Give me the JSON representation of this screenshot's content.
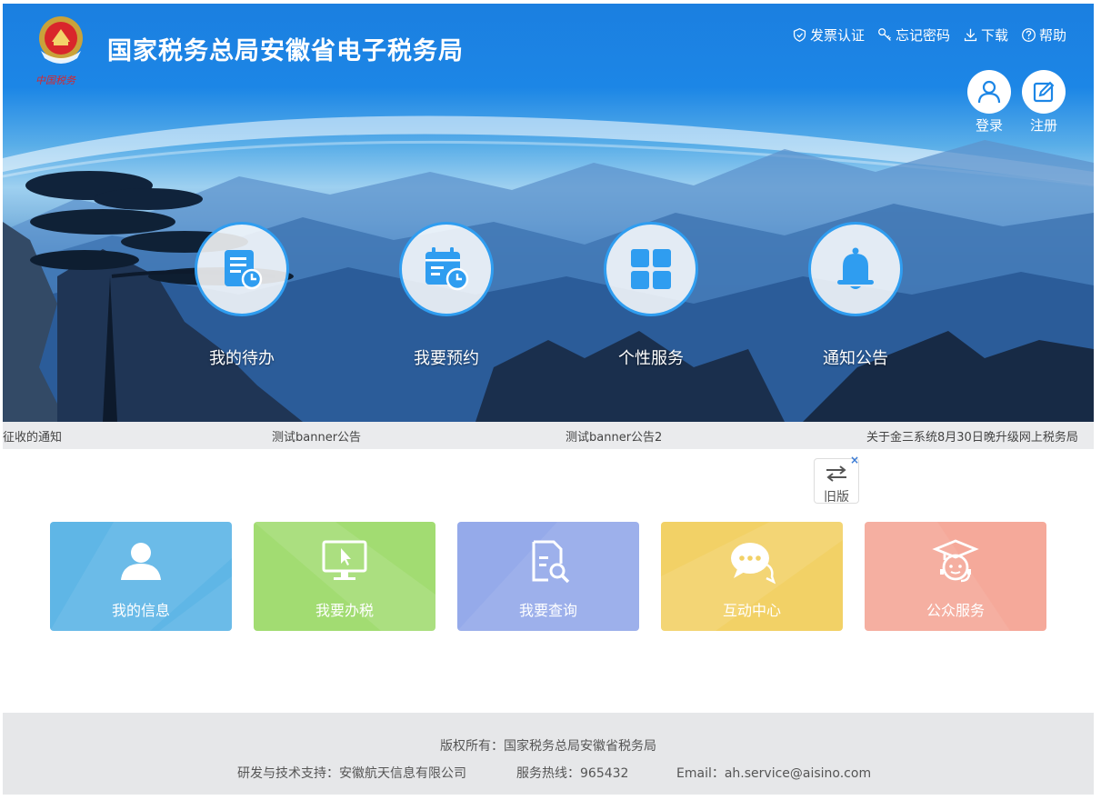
{
  "header": {
    "title": "国家税务总局安徽省电子税务局",
    "logo_text": "中国税务",
    "links": [
      {
        "label": "发票认证",
        "icon": "shield-check-icon"
      },
      {
        "label": "忘记密码",
        "icon": "key-icon"
      },
      {
        "label": "下载",
        "icon": "download-icon"
      },
      {
        "label": "帮助",
        "icon": "help-icon"
      }
    ],
    "login_label": "登录",
    "register_label": "注册"
  },
  "features": [
    {
      "label": "我的待办",
      "icon": "todo-document-icon"
    },
    {
      "label": "我要预约",
      "icon": "calendar-clock-icon"
    },
    {
      "label": "个性服务",
      "icon": "grid-icon"
    },
    {
      "label": "通知公告",
      "icon": "bell-icon"
    }
  ],
  "marquee": [
    "征收的通知",
    "测试banner公告",
    "测试banner公告2",
    "关于金三系统8月30日晚升级网上税务局"
  ],
  "old_version": {
    "label": "旧版",
    "close": "×"
  },
  "tiles": [
    {
      "label": "我的信息",
      "icon": "user-icon",
      "color": "#5fb6e6"
    },
    {
      "label": "我要办税",
      "icon": "monitor-cursor-icon",
      "color": "#a2dc72"
    },
    {
      "label": "我要查询",
      "icon": "document-search-icon",
      "color": "#95aaea"
    },
    {
      "label": "互动中心",
      "icon": "chat-bubble-icon",
      "color": "#f2d166"
    },
    {
      "label": "公众服务",
      "icon": "graduate-headset-icon",
      "color": "#f5a99a"
    }
  ],
  "footer": {
    "copyright": "版权所有：国家税务总局安徽省税务局",
    "support": "研发与技术支持：安徽航天信息有限公司",
    "hotline": "服务热线：965432",
    "email": "Email：ah.service@aisino.com"
  },
  "colors": {
    "brand_blue": "#1c86e6",
    "footer_bg": "#e6e7e9",
    "marquee_bg": "#eaebed"
  }
}
